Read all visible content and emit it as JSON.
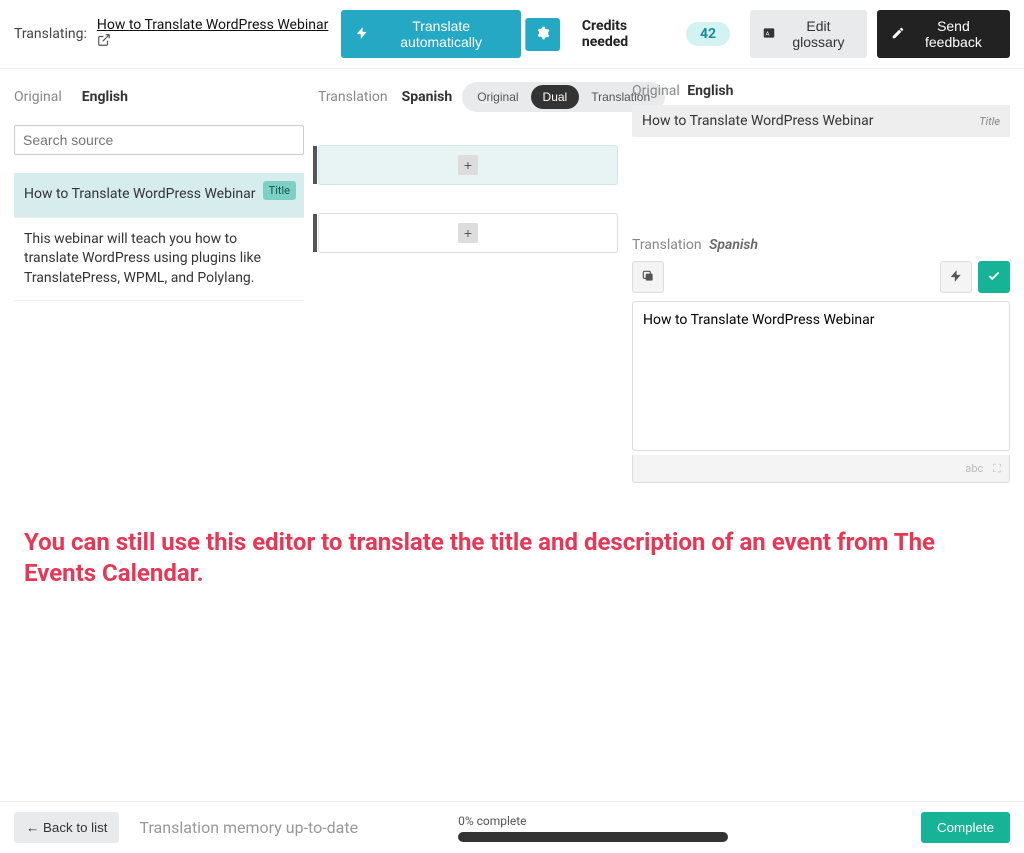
{
  "header": {
    "translating_label": "Translating:",
    "translating_title": "How to Translate WordPress Webinar",
    "translate_auto_label": "Translate automatically",
    "credits_label": "Credits needed",
    "credits_value": "42",
    "edit_glossary_label": "Edit glossary",
    "send_feedback_label": "Send feedback"
  },
  "left": {
    "original_label": "Original",
    "original_lang": "English",
    "search_placeholder": "Search source",
    "segments": [
      {
        "text": "How to Translate WordPress Webinar",
        "badge": "Title"
      },
      {
        "text": "This webinar will teach you how to translate WordPress using plugins like TranslatePress, WPML, and Polylang."
      }
    ]
  },
  "mid": {
    "translation_label": "Translation",
    "translation_lang": "Spanish",
    "view_toggle": {
      "original": "Original",
      "dual": "Dual",
      "translation": "Translation"
    }
  },
  "right": {
    "original_label": "Original",
    "original_lang": "English",
    "original_text": "How to Translate WordPress Webinar",
    "original_tag": "Title",
    "translation_label": "Translation",
    "translation_lang": "Spanish",
    "translation_value": "How to Translate WordPress Webinar",
    "footer_abc": "abc"
  },
  "callout": "You can still use this editor to translate the title and description of an event from The Events Calendar.",
  "footer": {
    "back_label": "← Back to list",
    "memory_label": "Translation memory up-to-date",
    "progress_label": "0% complete",
    "complete_label": "Complete"
  }
}
